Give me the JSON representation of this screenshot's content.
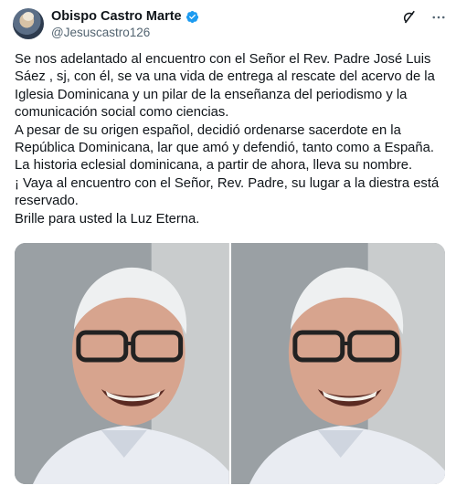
{
  "author": {
    "display_name": "Obispo Castro Marte",
    "handle": "@Jesuscastro126",
    "verified_icon": "verified-badge-icon",
    "avatar_icon": "avatar"
  },
  "actions": {
    "grok_icon": "grok-icon",
    "more_icon": "more-icon"
  },
  "tweet": {
    "paragraphs": [
      "Se nos adelantado al encuentro con el Señor el Rev. Padre José Luis Sáez , sj, con él, se va una vida de entrega al rescate del acervo de la Iglesia Dominicana y un pilar de la enseñanza del periodismo y la comunicación social como ciencias.",
      "A pesar de su origen español, decidió ordenarse sacerdote en la República Dominicana, lar que amó y defendió, tanto como a España. La historia eclesial dominicana, a partir de ahora, lleva su nombre.",
      "¡ Vaya al encuentro con el Señor, Rev. Padre,  su lugar a la diestra está reservado.",
      "Brille para usted la Luz Eterna."
    ]
  },
  "colors": {
    "text": "#0f1419",
    "secondary": "#536471",
    "verified": "#1d9bf0"
  }
}
